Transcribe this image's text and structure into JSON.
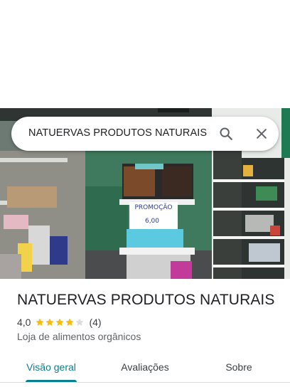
{
  "search": {
    "query": "NATUERVAS PRODUTOS NATURAIS",
    "search_icon": "search-icon",
    "close_icon": "close-icon"
  },
  "photo": {
    "sign_text": "PROMOÇÃO",
    "price_text": "6,00"
  },
  "place": {
    "name": "NATUERVAS PRODUTOS NATURAIS",
    "rating": "4,0",
    "stars_filled": 4,
    "stars_total": 5,
    "review_count": "(4)",
    "category": "Loja de alimentos orgânicos"
  },
  "tabs": [
    {
      "label": "Visão geral",
      "active": true
    },
    {
      "label": "Avaliações",
      "active": false
    },
    {
      "label": "Sobre",
      "active": false
    }
  ],
  "colors": {
    "accent": "#0b7f8d",
    "star": "#fbbc04",
    "star_empty": "#dadce0"
  }
}
